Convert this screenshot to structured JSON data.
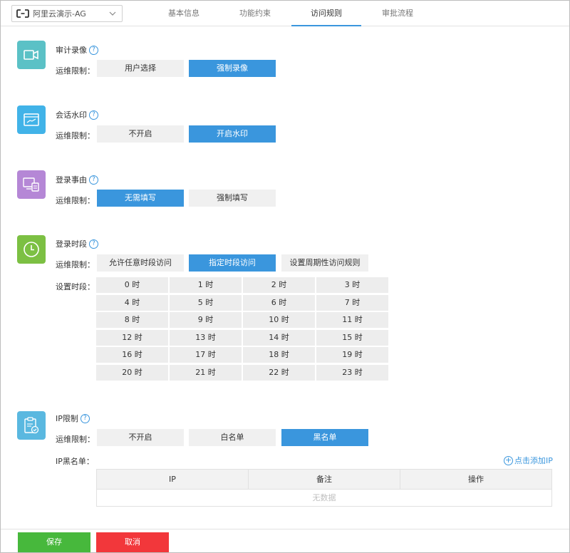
{
  "header": {
    "org_name": "阿里云演示-AG",
    "tabs": [
      "基本信息",
      "功能约束",
      "访问规则",
      "审批流程"
    ],
    "active_tab": 2
  },
  "colors": {
    "accent": "#3a96dd",
    "icon_video": "#5bc1c6",
    "icon_watermark": "#41b3e8",
    "icon_reason": "#b587d6",
    "icon_time": "#7cc043",
    "icon_ip": "#5ab8e0",
    "save": "#47b83c",
    "cancel": "#f2373b"
  },
  "sections": {
    "audit_video": {
      "title": "审计录像",
      "row_label": "运维限制：",
      "options": [
        "用户选择",
        "强制录像"
      ],
      "selected": 1
    },
    "watermark": {
      "title": "会话水印",
      "row_label": "运维限制：",
      "options": [
        "不开启",
        "开启水印"
      ],
      "selected": 1
    },
    "login_reason": {
      "title": "登录事由",
      "row_label": "运维限制：",
      "options": [
        "无需填写",
        "强制填写"
      ],
      "selected": 0
    },
    "login_time": {
      "title": "登录时段",
      "row_label": "运维限制：",
      "options": [
        "允许任意时段访问",
        "指定时段访问",
        "设置周期性访问规则"
      ],
      "selected": 1,
      "hours_label": "设置时段：",
      "hours": [
        "0 时",
        "1 时",
        "2 时",
        "3 时",
        "4 时",
        "5 时",
        "6 时",
        "7 时",
        "8 时",
        "9 时",
        "10 时",
        "11 时",
        "12 时",
        "13 时",
        "14 时",
        "15 时",
        "16 时",
        "17 时",
        "18 时",
        "19 时",
        "20 时",
        "21 时",
        "22 时",
        "23 时"
      ]
    },
    "ip_limit": {
      "title": "IP限制",
      "row_label": "运维限制：",
      "options": [
        "不开启",
        "白名单",
        "黑名单"
      ],
      "selected": 2,
      "list_label": "IP黑名单：",
      "add_label": "点击添加IP",
      "columns": [
        "IP",
        "备注",
        "操作"
      ],
      "empty_text": "无数据"
    }
  },
  "footer": {
    "save_label": "保存",
    "cancel_label": "取消"
  }
}
